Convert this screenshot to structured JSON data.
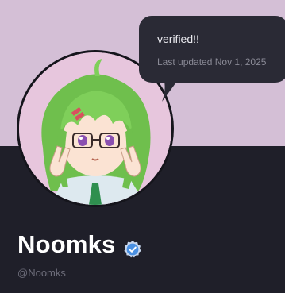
{
  "profile": {
    "display_name": "Noomks",
    "handle": "@Noomks",
    "verified": true
  },
  "tooltip": {
    "title": "verified!!",
    "subtitle": "Last updated Nov 1, 2025"
  },
  "colors": {
    "banner": "#d4bfd6",
    "background": "#1f1f29",
    "tooltip_bg": "#2a2a35",
    "verified_badge": "#4a90e2",
    "avatar_hair": "#7fcf5a"
  },
  "icons": {
    "verified": "verified-check-icon"
  }
}
